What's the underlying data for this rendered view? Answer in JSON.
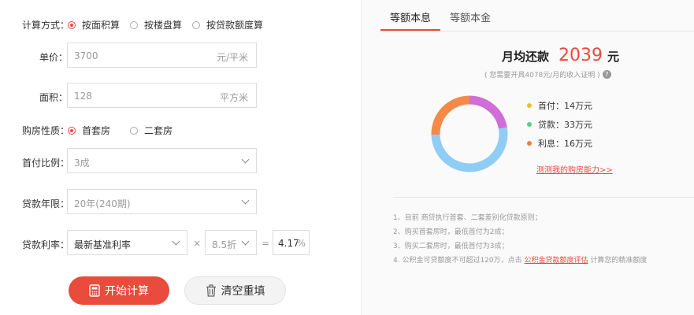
{
  "form": {
    "calc_method": {
      "label": "计算方式：",
      "options": [
        "按面积算",
        "按楼盘算",
        "按贷款额度算"
      ],
      "selected": 0
    },
    "unit_price": {
      "label": "单价：",
      "value": "3700",
      "unit": "元/平米"
    },
    "area": {
      "label": "面积：",
      "value": "128",
      "unit": "平方米"
    },
    "house_type": {
      "label": "购房性质：",
      "options": [
        "首套房",
        "二套房"
      ],
      "selected": 0
    },
    "down_payment": {
      "label": "首付比例：",
      "value": "3成"
    },
    "loan_years": {
      "label": "贷款年限：",
      "value": "20年(240期)"
    },
    "rate": {
      "label": "贷款利率：",
      "base": "最新基准利率",
      "times": "×",
      "discount": "8.5折",
      "equals": "=",
      "result": "4.17",
      "percent": "%"
    },
    "buttons": {
      "calculate": "开始计算",
      "reset": "清空重填"
    }
  },
  "result": {
    "tabs": [
      "等额本息",
      "等额本金"
    ],
    "active_tab": 0,
    "monthly_label": "月均还款",
    "monthly_value": "2039",
    "monthly_unit": "元",
    "income_note": "( 您需要开具4078元/月的收入证明 )",
    "legend": [
      {
        "label": "首付：",
        "value": "14万元",
        "color": "#f5b82e"
      },
      {
        "label": "贷款：",
        "value": "33万元",
        "color": "#5ecb8a"
      },
      {
        "label": "利息：",
        "value": "16万元",
        "color": "#f07e3a"
      }
    ],
    "donut": [
      {
        "name": "首付",
        "value": 14,
        "color": "#ce6ed6"
      },
      {
        "name": "贷款",
        "value": 33,
        "color": "#8fcdf4"
      },
      {
        "name": "利息",
        "value": 16,
        "color": "#f48a48"
      }
    ],
    "capacity_link": "测测我的购房能力>>",
    "tips": {
      "line1": "1、目前 商贷执行首套、二套差别化贷款原则；",
      "line2": "2、购买首套房时，最低首付为2成；",
      "line3": "3、购买二套房时，最低首付为3成；",
      "line4_pre": "4. 公积金可贷额度不可超过120万，点击",
      "line4_link": "公积金贷款额度评估",
      "line4_post": "计算您的精准额度"
    }
  }
}
